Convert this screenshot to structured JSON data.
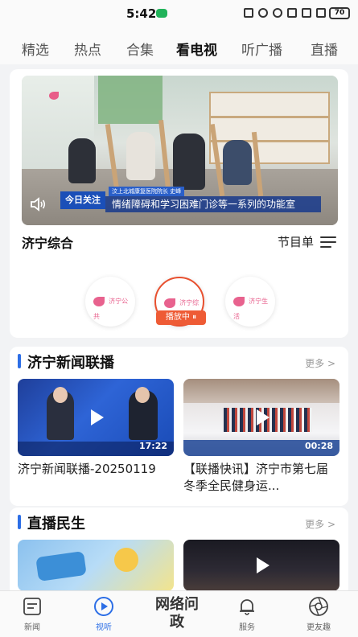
{
  "status_bar": {
    "time": "5:42",
    "battery": "70"
  },
  "tabs": [
    {
      "label": "精选"
    },
    {
      "label": "热点"
    },
    {
      "label": "合集"
    },
    {
      "label": "看电视"
    },
    {
      "label": "听广播"
    },
    {
      "label": "直播"
    }
  ],
  "player": {
    "ticker_tag": "今日关注",
    "ticker_subtitle": "汶上北城康复医院院长 史峰",
    "ticker_main": "情绪障碍和学习困难门诊等一系列的功能室",
    "channel_name": "济宁综合",
    "schedule_label": "节目单",
    "channels": [
      {
        "name": "济宁公共"
      },
      {
        "name": "济宁综合"
      },
      {
        "name": "济宁生活"
      }
    ],
    "playing_badge": "播放中 ⏸"
  },
  "news_section": {
    "title": "济宁新闻联播",
    "more": "更多 >",
    "items": [
      {
        "title": "济宁新闻联播-20250119",
        "duration": "17:22"
      },
      {
        "title": "【联播快讯】济宁市第七届冬季全民健身运...",
        "duration": "00:28"
      }
    ]
  },
  "live_section": {
    "title": "直播民生",
    "more": "更多 >"
  },
  "bottom_nav": [
    {
      "label": "新闻"
    },
    {
      "label": "视听"
    },
    {
      "label": "网络问政"
    },
    {
      "label": "服务"
    },
    {
      "label": "更友趣"
    }
  ]
}
